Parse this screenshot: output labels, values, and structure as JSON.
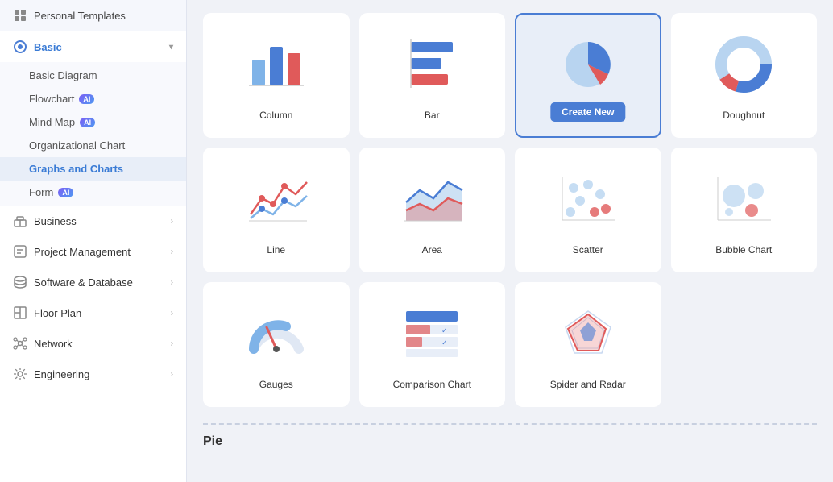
{
  "sidebar": {
    "personal_templates_label": "Personal Templates",
    "sections": [
      {
        "id": "basic",
        "label": "Basic",
        "icon": "basic-icon",
        "expanded": true,
        "active": true,
        "sub_items": [
          {
            "id": "basic-diagram",
            "label": "Basic Diagram",
            "ai": false,
            "active": false
          },
          {
            "id": "flowchart",
            "label": "Flowchart",
            "ai": true,
            "active": false
          },
          {
            "id": "mind-map",
            "label": "Mind Map",
            "ai": true,
            "active": false
          },
          {
            "id": "org-chart",
            "label": "Organizational Chart",
            "ai": false,
            "active": false
          },
          {
            "id": "graphs-charts",
            "label": "Graphs and Charts",
            "ai": false,
            "active": true
          },
          {
            "id": "form",
            "label": "Form",
            "ai": true,
            "active": false
          }
        ]
      },
      {
        "id": "business",
        "label": "Business",
        "icon": "business-icon",
        "expanded": false
      },
      {
        "id": "project-management",
        "label": "Project Management",
        "icon": "project-icon",
        "expanded": false
      },
      {
        "id": "software-database",
        "label": "Software & Database",
        "icon": "software-icon",
        "expanded": false
      },
      {
        "id": "floor-plan",
        "label": "Floor Plan",
        "icon": "floor-icon",
        "expanded": false
      },
      {
        "id": "network",
        "label": "Network",
        "icon": "network-icon",
        "expanded": false
      },
      {
        "id": "engineering",
        "label": "Engineering",
        "icon": "engineering-icon",
        "expanded": false
      }
    ]
  },
  "main": {
    "charts": [
      {
        "id": "column",
        "label": "Column",
        "selected": false
      },
      {
        "id": "bar",
        "label": "Bar",
        "selected": false
      },
      {
        "id": "pie",
        "label": "Pie",
        "selected": true,
        "create_new": "Create New"
      },
      {
        "id": "doughnut",
        "label": "Doughnut",
        "selected": false
      },
      {
        "id": "line",
        "label": "Line",
        "selected": false
      },
      {
        "id": "area",
        "label": "Area",
        "selected": false
      },
      {
        "id": "scatter",
        "label": "Scatter",
        "selected": false
      },
      {
        "id": "bubble-chart",
        "label": "Bubble Chart",
        "selected": false
      },
      {
        "id": "gauges",
        "label": "Gauges",
        "selected": false
      },
      {
        "id": "comparison-chart",
        "label": "Comparison Chart",
        "selected": false
      },
      {
        "id": "spider-radar",
        "label": "Spider and Radar",
        "selected": false
      }
    ],
    "bottom_label": "Pie"
  },
  "colors": {
    "blue": "#4a7dd4",
    "red": "#e05a5a",
    "light_blue": "#7fb3e8",
    "teal": "#5bbcd6",
    "accent": "#3a7bd5"
  }
}
